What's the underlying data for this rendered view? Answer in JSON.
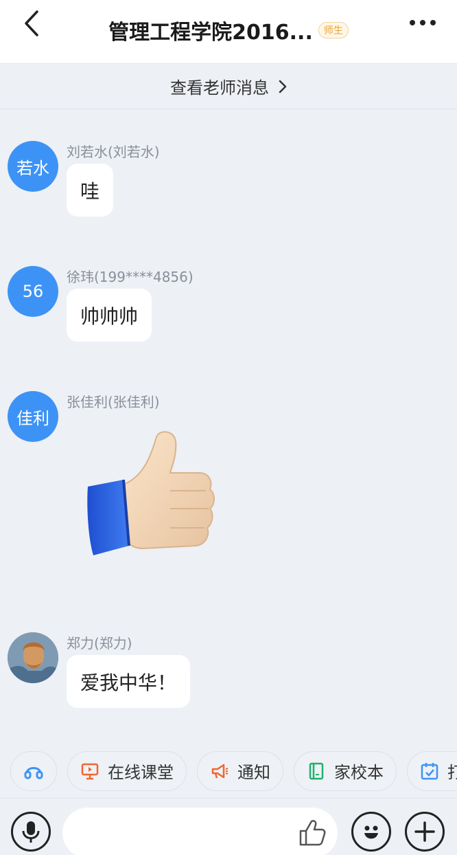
{
  "header": {
    "title": "管理工程学院2016...",
    "badge": "师生",
    "back_icon": "chevron-left-icon",
    "more_icon": "more-horizontal-icon"
  },
  "teacher_bar": {
    "label": "查看老师消息"
  },
  "messages": [
    {
      "avatar_text": "若水",
      "sender": "刘若水(刘若水)",
      "text": "哇"
    },
    {
      "avatar_text": "56",
      "sender": "徐玮(199****4856)",
      "text": "帅帅帅"
    },
    {
      "avatar_text": "佳利",
      "sender": "张佳利(张佳利)",
      "sticker": "thumbs-up-sticker"
    },
    {
      "avatar_icon": "portrait-avatar",
      "sender": "郑力(郑力)",
      "text": "爱我中华！"
    }
  ],
  "quick_actions": [
    {
      "icon": "headset-icon",
      "label": ""
    },
    {
      "icon": "presentation-icon",
      "label": "在线课堂",
      "color": "#f0662f"
    },
    {
      "icon": "megaphone-icon",
      "label": "通知",
      "color": "#f0662f"
    },
    {
      "icon": "notebook-icon",
      "label": "家校本",
      "color": "#22b06e"
    },
    {
      "icon": "calendar-check-icon",
      "label": "打",
      "color": "#3d93f5"
    }
  ],
  "input_bar": {
    "placeholder": "",
    "voice_icon": "microphone-icon",
    "like_icon": "thumbs-up-icon",
    "emoji_icon": "smiley-icon",
    "plus_icon": "plus-icon"
  },
  "colors": {
    "accent": "#3d93f5",
    "background": "#edf0f5",
    "badge": "#e6a23c"
  }
}
